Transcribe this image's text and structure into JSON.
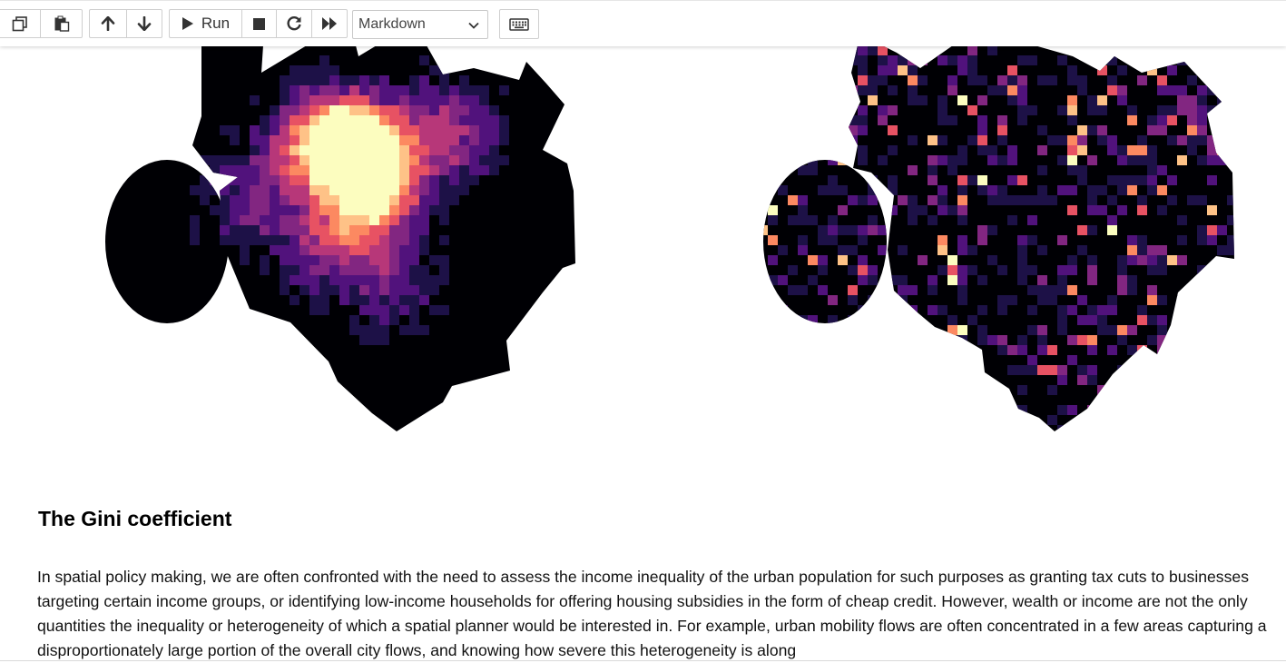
{
  "toolbar": {
    "run_label": "Run",
    "cell_type": "Markdown",
    "cell_type_options": [
      "Markdown"
    ]
  },
  "figure": {
    "colormap": [
      "#000004",
      "#1d1147",
      "#51127c",
      "#822681",
      "#b73779",
      "#e75263",
      "#fc8961",
      "#fec287",
      "#fcfdbf"
    ],
    "panels": [
      "concentrated-density-map",
      "dispersed-density-map"
    ]
  },
  "notebook": {
    "heading": "The Gini coefficient",
    "paragraph": "In spatial policy making, we are often confronted with the need to assess the income inequality of the urban population for such purposes as granting tax cuts to businesses targeting certain income groups, or identifying low-income households for offering housing subsidies in the form of cheap credit. However, wealth or income are not the only quantities the inequality or heterogeneity of which a spatial planner would be interested in. For example, urban mobility flows are often concentrated in a few areas capturing a disproportionately large portion of the overall city flows, and knowing how severe this heterogeneity is along"
  }
}
